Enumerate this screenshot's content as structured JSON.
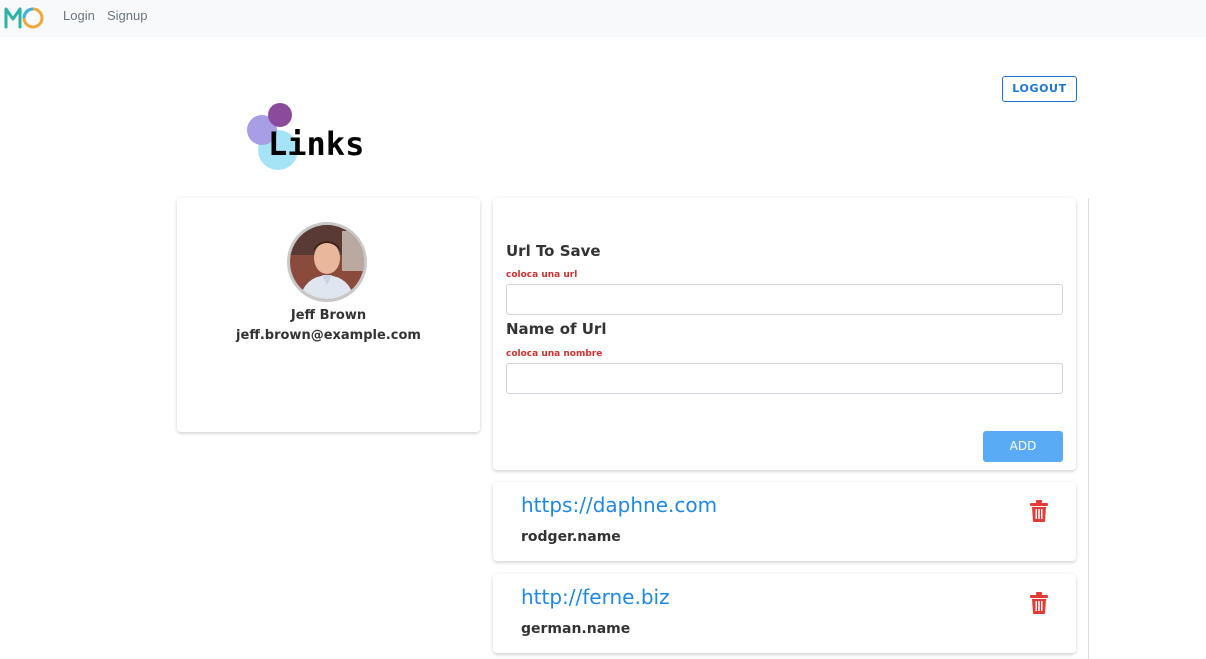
{
  "nav": {
    "logo": "logo-icon",
    "login": "Login",
    "signup": "Signup"
  },
  "header": {
    "logout": "LOGOUT",
    "title": "Links"
  },
  "profile": {
    "name": "Jeff Brown",
    "email": "jeff.brown@example.com"
  },
  "form": {
    "url_label": "Url To Save",
    "url_hint": "coloca una url",
    "url_value": "",
    "name_label": "Name of Url",
    "name_hint": "coloca una nombre",
    "name_value": "",
    "add_label": "ADD"
  },
  "links": [
    {
      "url": "https://daphne.com",
      "name": "rodger.name",
      "icon": "trash-icon"
    },
    {
      "url": "http://ferne.biz",
      "name": "german.name",
      "icon": "trash-icon"
    }
  ],
  "colors": {
    "accent": "#1976d2",
    "link": "#1e88e5",
    "error": "#d32f2f",
    "add_button": "#5aabf5",
    "delete": "#e53935"
  }
}
